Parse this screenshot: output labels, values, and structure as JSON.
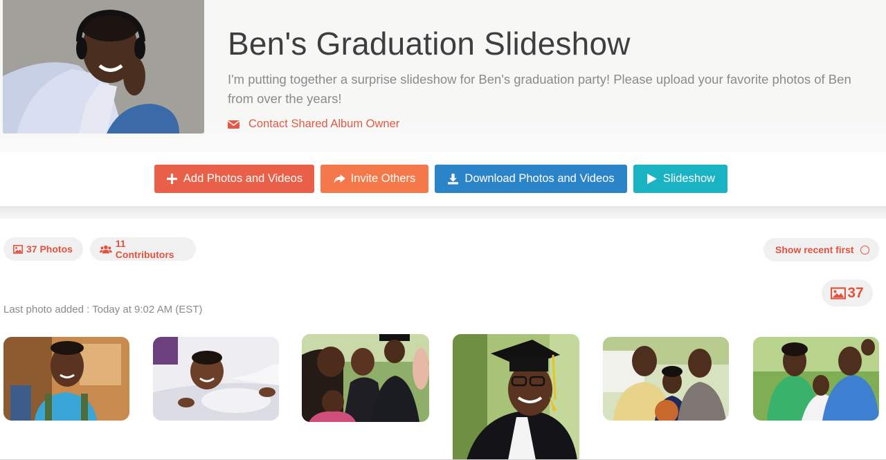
{
  "album": {
    "title": "Ben's Graduation Slideshow",
    "description": "I'm putting together a surprise slideshow for Ben's graduation party! Please upload your favorite photos of Ben from over the years!",
    "contact_label": "Contact Shared Album Owner"
  },
  "actions": {
    "add_label": "Add Photos and Videos",
    "invite_label": "Invite Others",
    "download_label": "Download Photos and Videos",
    "slideshow_label": "Slideshow"
  },
  "stats": {
    "photos_label": "37 Photos",
    "contributors_label": "11 Contributors",
    "sort_label": "Show recent first",
    "photo_count": "37"
  },
  "last_added": "Last photo added : Today at 9:02 AM (EST)",
  "colors": {
    "accent_red": "#e95f47",
    "accent_orange": "#f4784a",
    "accent_blue": "#2c84c8",
    "accent_teal": "#1ab3c3",
    "link_red": "#e2523e"
  },
  "icons": {
    "contact": "envelope-icon",
    "add": "plus-icon",
    "invite": "share-arrow-icon",
    "download": "download-icon",
    "slideshow": "play-icon",
    "photos": "image-icon",
    "contributors": "users-icon"
  }
}
